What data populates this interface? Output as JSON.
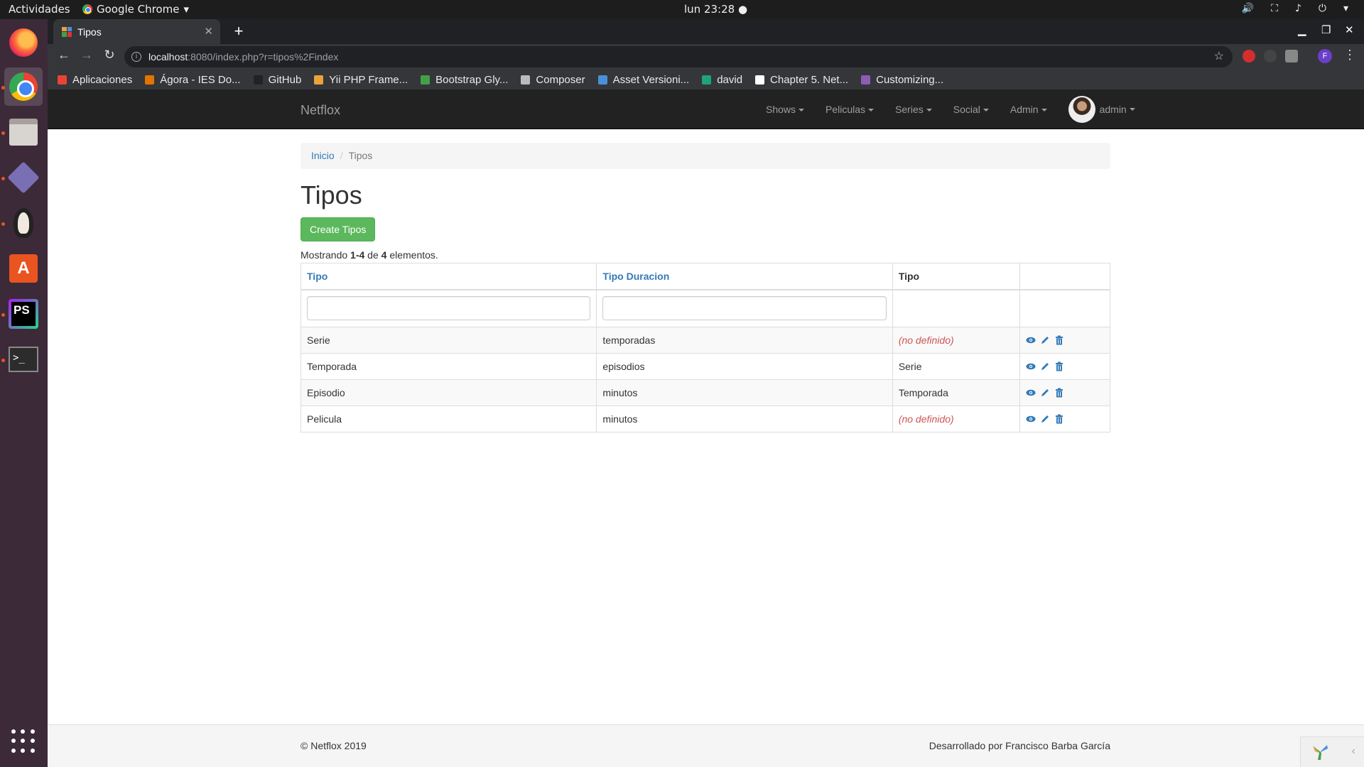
{
  "system_bar": {
    "activities": "Actividades",
    "app_name": "Google Chrome",
    "clock": "lun 23:28 ●"
  },
  "browser": {
    "tab_title": "Tipos",
    "url_host": "localhost",
    "url_rest": ":8080/index.php?r=tipos%2Findex",
    "profile_initial": "F",
    "bookmarks": [
      {
        "label": "Aplicaciones",
        "color": "#ea4335"
      },
      {
        "label": "Ágora - IES Do...",
        "color": "#e37400"
      },
      {
        "label": "GitHub",
        "color": "#222222"
      },
      {
        "label": "Yii PHP Frame...",
        "color": "#e8a33b"
      },
      {
        "label": "Bootstrap Gly...",
        "color": "#43a047"
      },
      {
        "label": "Composer",
        "color": "#bbbbbb"
      },
      {
        "label": "Asset Versioni...",
        "color": "#4a90d9"
      },
      {
        "label": "david",
        "color": "#1fa37a"
      },
      {
        "label": "Chapter 5. Net...",
        "color": "#ffffff"
      },
      {
        "label": "Customizing...",
        "color": "#8e5bb5"
      }
    ]
  },
  "navbar": {
    "brand": "Netflox",
    "items": [
      {
        "label": "Shows"
      },
      {
        "label": "Peliculas"
      },
      {
        "label": "Series"
      },
      {
        "label": "Social"
      },
      {
        "label": "Admin"
      }
    ],
    "user": "admin"
  },
  "breadcrumb": {
    "home": "Inicio",
    "current": "Tipos"
  },
  "page": {
    "title": "Tipos",
    "create_button": "Create Tipos",
    "summary_prefix": "Mostrando ",
    "summary_range": "1-4",
    "summary_mid": " de ",
    "summary_total": "4",
    "summary_suffix": " elementos."
  },
  "table": {
    "headers": [
      "Tipo",
      "Tipo Duracion",
      "Tipo",
      ""
    ],
    "rows": [
      {
        "tipo": "Serie",
        "duracion": "temporadas",
        "padre": "(no definido)",
        "padre_set": false
      },
      {
        "tipo": "Temporada",
        "duracion": "episodios",
        "padre": "Serie",
        "padre_set": true
      },
      {
        "tipo": "Episodio",
        "duracion": "minutos",
        "padre": "Temporada",
        "padre_set": true
      },
      {
        "tipo": "Pelicula",
        "duracion": "minutos",
        "padre": "(no definido)",
        "padre_set": false
      }
    ]
  },
  "footer": {
    "left": "© Netflox 2019",
    "right": "Desarrollado por Francisco Barba García"
  },
  "colors": {
    "link": "#337ab7",
    "success": "#5cb85c",
    "not_set": "#cc5555"
  }
}
